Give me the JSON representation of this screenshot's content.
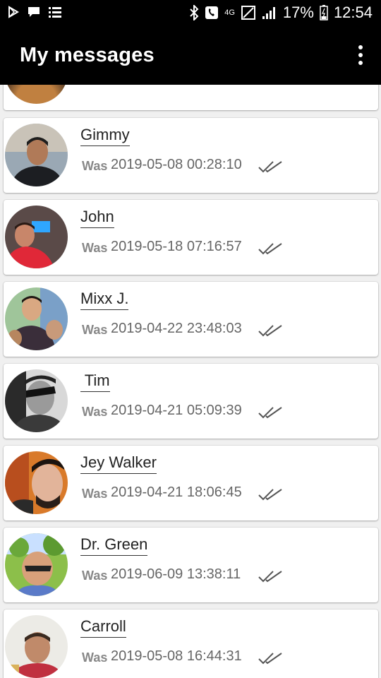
{
  "status_bar": {
    "battery": "17%",
    "time": "12:54",
    "network": "4G"
  },
  "app_bar": {
    "title": "My messages"
  },
  "contacts": [
    {
      "name": "Gimmy",
      "was_label": "Was",
      "last_seen": "2019-05-08 00:28:10"
    },
    {
      "name": "John",
      "was_label": "Was",
      "last_seen": "2019-05-18 07:16:57"
    },
    {
      "name": "Mixx J.",
      "was_label": "Was",
      "last_seen": "2019-04-22 23:48:03"
    },
    {
      "name": " Tim",
      "was_label": "Was",
      "last_seen": "2019-04-21 05:09:39"
    },
    {
      "name": "Jey Walker",
      "was_label": "Was",
      "last_seen": "2019-04-21 18:06:45"
    },
    {
      "name": "Dr. Green",
      "was_label": "Was",
      "last_seen": "2019-06-09 13:38:11"
    },
    {
      "name": "Carroll",
      "was_label": "Was",
      "last_seen": "2019-05-08 16:44:31"
    }
  ],
  "colors": {
    "app_bar": "#000000",
    "list_background": "#f0f0f0",
    "card": "#ffffff",
    "ticks": "#555555"
  }
}
